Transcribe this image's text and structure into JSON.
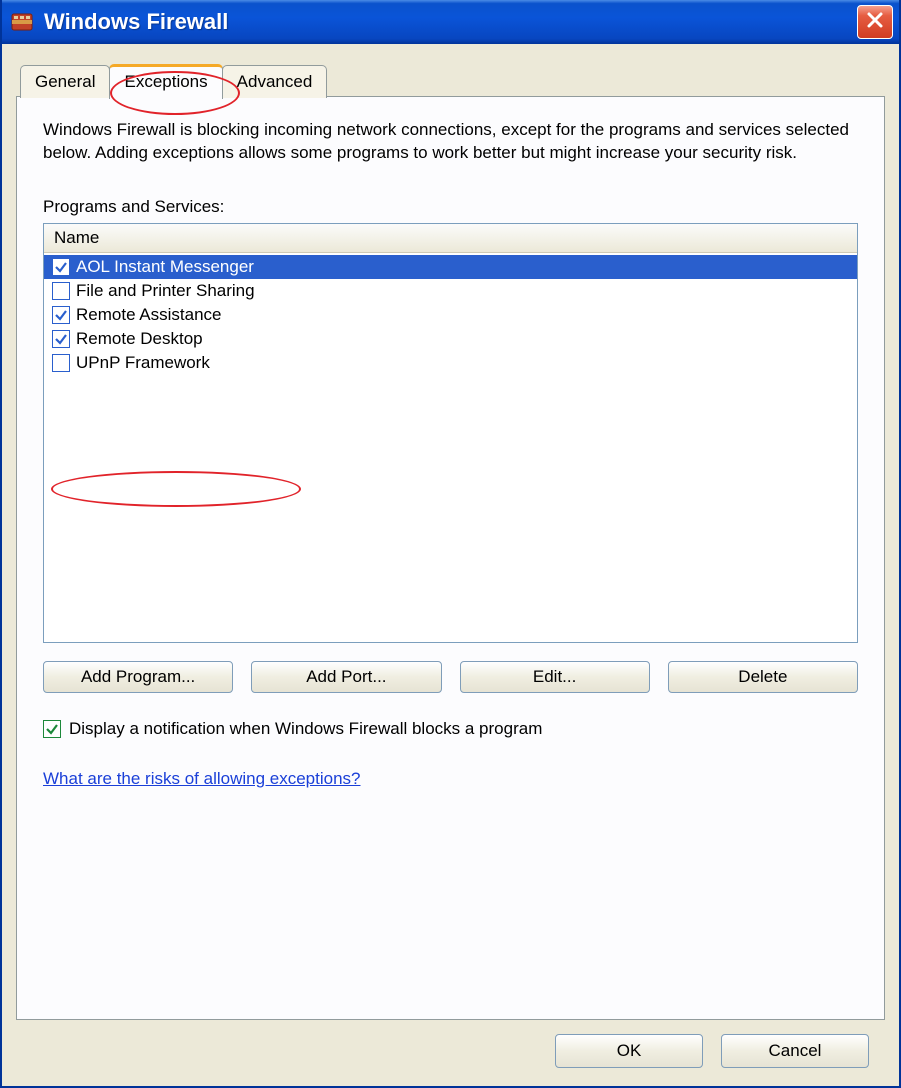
{
  "window": {
    "title": "Windows Firewall"
  },
  "tabs": [
    {
      "label": "General",
      "active": false
    },
    {
      "label": "Exceptions",
      "active": true
    },
    {
      "label": "Advanced",
      "active": false
    }
  ],
  "description": "Windows Firewall is blocking incoming network connections, except for the programs and services selected below. Adding exceptions allows some programs to work better but might increase your security risk.",
  "list_label": "Programs and Services:",
  "list_header": "Name",
  "items": [
    {
      "label": "AOL Instant Messenger",
      "checked": true,
      "selected": true
    },
    {
      "label": "File and Printer Sharing",
      "checked": false,
      "selected": false
    },
    {
      "label": "Remote Assistance",
      "checked": true,
      "selected": false
    },
    {
      "label": "Remote Desktop",
      "checked": true,
      "selected": false
    },
    {
      "label": "UPnP Framework",
      "checked": false,
      "selected": false
    }
  ],
  "buttons": {
    "add_program": "Add Program...",
    "add_port": "Add Port...",
    "edit": "Edit...",
    "delete": "Delete"
  },
  "notify": {
    "checked": true,
    "label": "Display a notification when Windows Firewall blocks a program"
  },
  "risks_link": "What are the risks of allowing exceptions?",
  "dialog_buttons": {
    "ok": "OK",
    "cancel": "Cancel"
  }
}
